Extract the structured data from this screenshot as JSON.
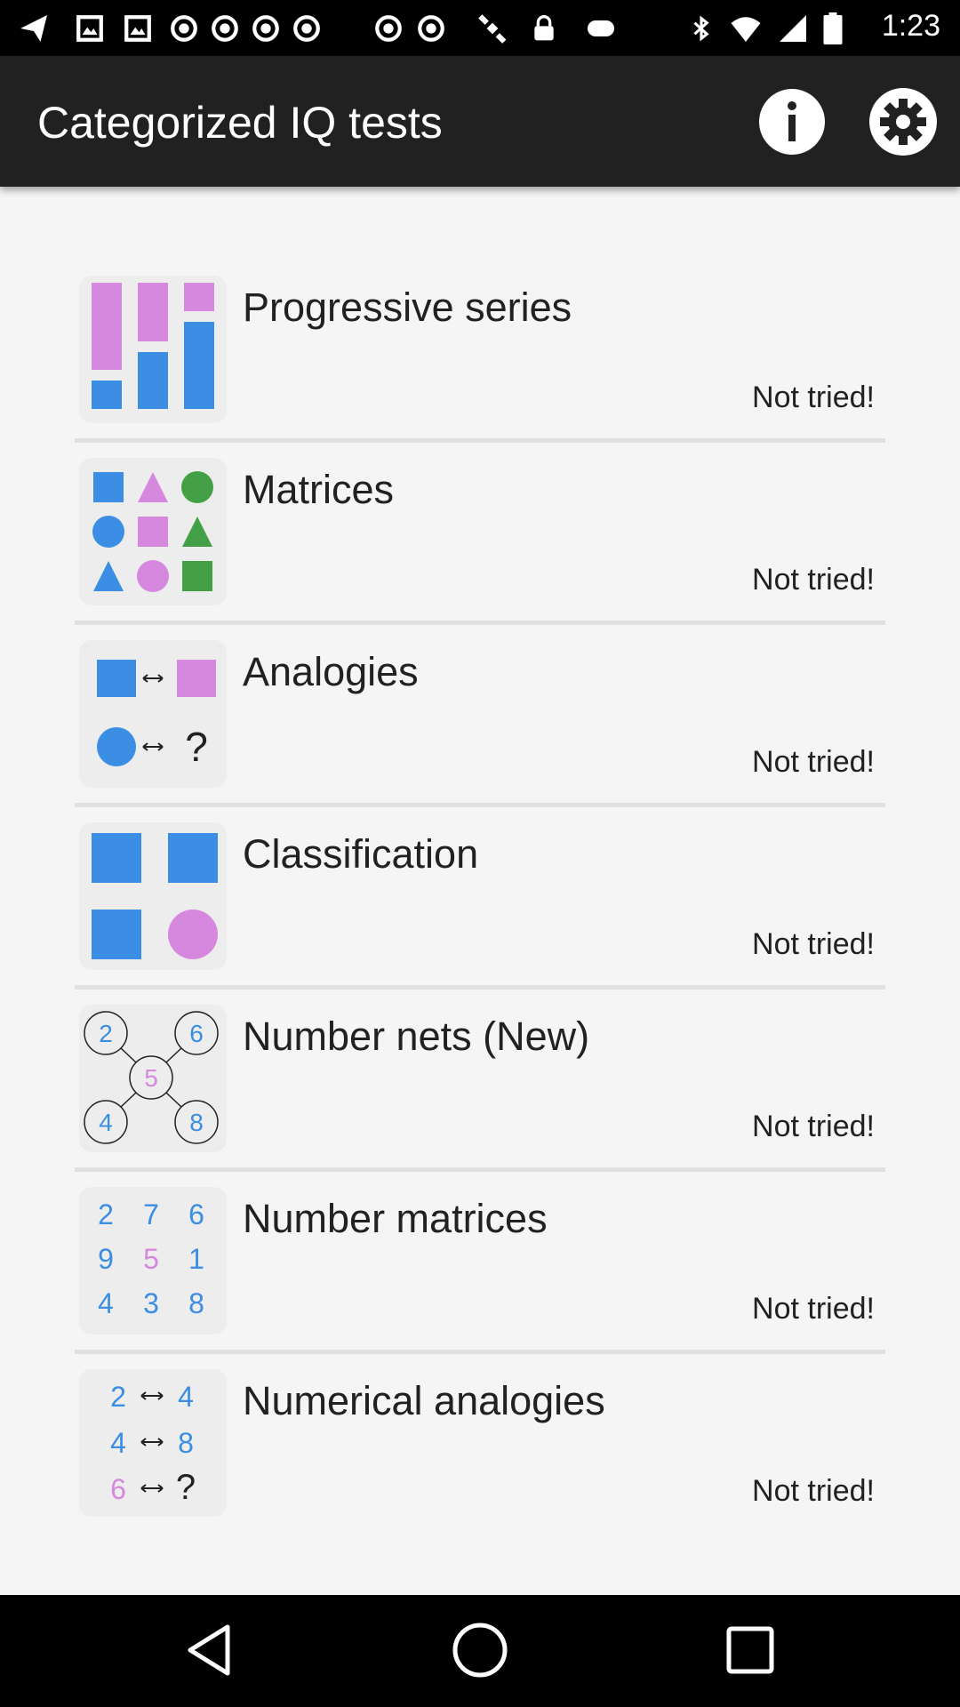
{
  "status_bar": {
    "time": "1:23",
    "icons": [
      "send-icon",
      "image-icon",
      "image-icon",
      "record-icon",
      "record-icon",
      "satellite-icon",
      "lock-icon",
      "gamepad-icon",
      "bluetooth-icon",
      "wifi-icon",
      "signal-icon",
      "battery-icon"
    ]
  },
  "app_bar": {
    "title": "Categorized IQ tests",
    "actions": [
      "info-icon",
      "settings-icon"
    ]
  },
  "colors": {
    "blue": "#3b8ee3",
    "pink": "#d588dd",
    "green": "#43a047",
    "appbar": "#212121",
    "background": "#f5f5f5"
  },
  "tests": [
    {
      "title": "Progressive series",
      "status": "Not tried!",
      "icon": "progressive-series-icon"
    },
    {
      "title": "Matrices",
      "status": "Not tried!",
      "icon": "matrices-icon"
    },
    {
      "title": "Analogies",
      "status": "Not tried!",
      "icon": "analogies-icon",
      "icon_text": [
        "?"
      ]
    },
    {
      "title": "Classification",
      "status": "Not tried!",
      "icon": "classification-icon"
    },
    {
      "title": "Number nets (New)",
      "status": "Not tried!",
      "icon": "number-nets-icon",
      "icon_text": [
        "2",
        "6",
        "5",
        "4",
        "8"
      ]
    },
    {
      "title": "Number matrices",
      "status": "Not tried!",
      "icon": "number-matrices-icon",
      "icon_text": [
        "2",
        "7",
        "6",
        "9",
        "5",
        "1",
        "4",
        "3",
        "8"
      ]
    },
    {
      "title": "Numerical analogies",
      "status": "Not tried!",
      "icon": "numerical-analogies-icon",
      "icon_text": [
        "2",
        "4",
        "4",
        "8",
        "6",
        "?"
      ]
    }
  ],
  "nav_bar": [
    "back-icon",
    "home-icon",
    "recents-icon"
  ]
}
